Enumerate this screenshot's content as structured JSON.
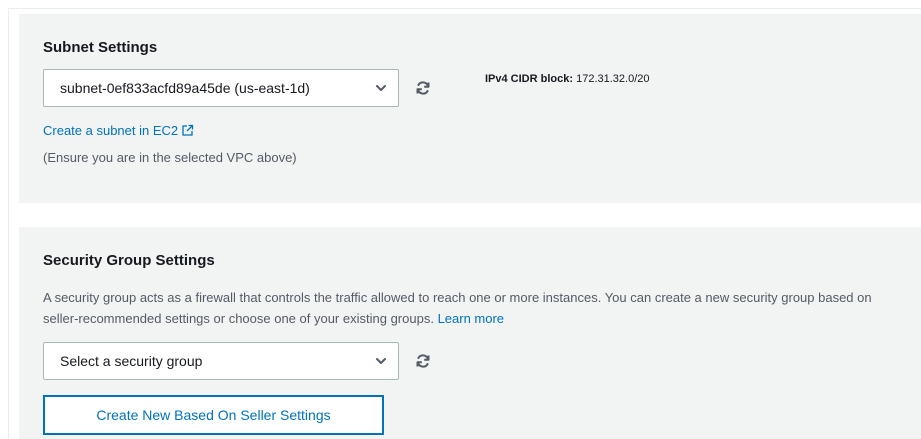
{
  "subnet": {
    "title": "Subnet Settings",
    "selected_subnet": "subnet-0ef833acfd89a45de (us-east-1d)",
    "cidr_label": "IPv4 CIDR block:",
    "cidr_value": "172.31.32.0/20",
    "create_link": "Create a subnet in EC2",
    "note": "(Ensure you are in the selected VPC above)"
  },
  "security_group": {
    "title": "Security Group Settings",
    "description": "A security group acts as a firewall that controls the traffic allowed to reach one or more instances. You can create a new security group based on seller-recommended settings or choose one of your existing groups.",
    "learn_more": "Learn more",
    "select_placeholder": "Select a security group",
    "create_button": "Create New Based On Seller Settings"
  },
  "colors": {
    "link": "#0073bb",
    "panel_bg": "#f2f3f3",
    "border": "#aab7b8"
  },
  "icons": [
    "refresh-icon",
    "chevron-down-icon",
    "external-link-icon"
  ]
}
